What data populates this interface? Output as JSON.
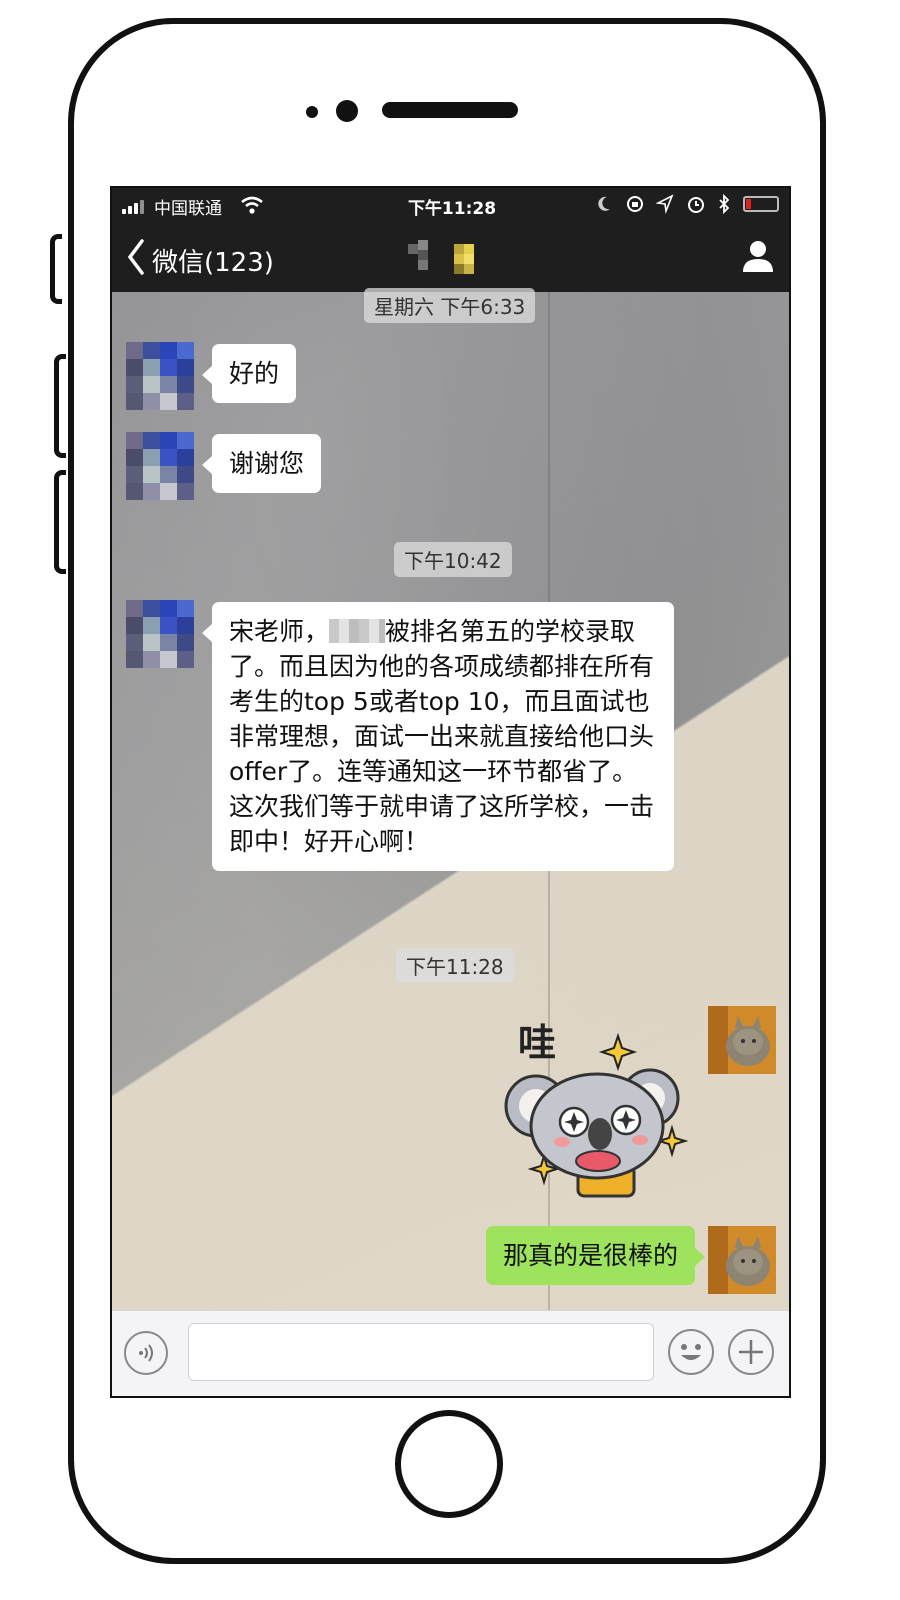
{
  "status_bar": {
    "carrier": "中国联通",
    "time": "下午11:28",
    "icons": [
      "moon-icon",
      "orientation-lock-icon",
      "location-icon",
      "alarm-icon",
      "bluetooth-icon",
      "battery-icon"
    ],
    "battery_color": "#e02020"
  },
  "nav": {
    "back_label": "微信(123)",
    "profile_icon": "person-icon"
  },
  "messages": [
    {
      "type": "timestamp",
      "text": "星期六 下午6:33"
    },
    {
      "type": "incoming",
      "text": "好的"
    },
    {
      "type": "incoming",
      "text": "谢谢您"
    },
    {
      "type": "timestamp",
      "text": "下午10:42"
    },
    {
      "type": "incoming",
      "text_before": "宋老师，",
      "text_after": "被排名第五的学校录取了。而且因为他的各项成绩都排在所有考生的top 5或者top 10，而且面试也非常理想，面试一出来就直接给他口头offer了。连等通知这一环节都省了。这次我们等于就申请了这所学校，一击即中！好开心啊！"
    },
    {
      "type": "timestamp",
      "text": "下午11:28"
    },
    {
      "type": "outgoing-sticker",
      "sticker_text": "哇"
    },
    {
      "type": "outgoing",
      "text": "那真的是很棒的"
    }
  ],
  "colors": {
    "outgoing_bubble": "#9de35e",
    "incoming_bubble": "#ffffff",
    "nav_background": "#1e1e1e"
  }
}
